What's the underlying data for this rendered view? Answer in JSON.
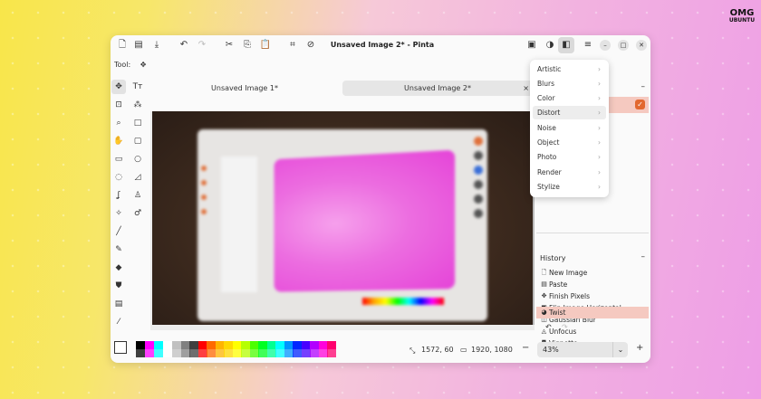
{
  "logo": {
    "top": "OMG",
    "bottom": "UBUNTU"
  },
  "window": {
    "title": "Unsaved Image 2* - Pinta"
  },
  "toolbar": {
    "tool_label": "Tool:"
  },
  "tabs": [
    {
      "label": "Unsaved Image 1*"
    },
    {
      "label": "Unsaved Image 2*"
    }
  ],
  "tab_close": "×",
  "adjustments_menu": {
    "items": [
      {
        "label": "Artistic"
      },
      {
        "label": "Blurs"
      },
      {
        "label": "Color"
      },
      {
        "label": "Distort"
      },
      {
        "label": "Noise"
      },
      {
        "label": "Object"
      },
      {
        "label": "Photo"
      },
      {
        "label": "Render"
      },
      {
        "label": "Stylize"
      }
    ],
    "highlighted": "Distort"
  },
  "history": {
    "title": "History",
    "items": [
      {
        "label": "New Image",
        "icon": "new-image-icon"
      },
      {
        "label": "Paste",
        "icon": "paste-icon"
      },
      {
        "label": "Finish Pixels",
        "icon": "move-icon"
      },
      {
        "label": "Flip Image Horizontal",
        "icon": "flip-icon"
      },
      {
        "label": "Gaussian Blur",
        "icon": "blur-icon"
      },
      {
        "label": "Unfocus",
        "icon": "unfocus-icon"
      },
      {
        "label": "Vignette",
        "icon": "vignette-icon"
      },
      {
        "label": "Twist",
        "icon": "twist-icon"
      }
    ],
    "selected": "Twist"
  },
  "status": {
    "cursor_pos": "1572, 60",
    "selection_size": "1920, 1080"
  },
  "zoom": {
    "value": "43%",
    "minus": "−",
    "plus": "+"
  },
  "palette": {
    "primary": "#ffffff",
    "secondary": "#000000",
    "colors": [
      "#000000",
      "#ff00ff",
      "#00ffff",
      "#ffffff",
      "#c0c0c0",
      "#808080",
      "#404040",
      "#ff0000",
      "#ff6a00",
      "#ffb400",
      "#ffd800",
      "#ffff00",
      "#b6ff00",
      "#4cff00",
      "#00ff21",
      "#00ff90",
      "#00ffff",
      "#0094ff",
      "#0026ff",
      "#4800ff",
      "#b200ff",
      "#ff00dc",
      "#ff006e"
    ]
  }
}
